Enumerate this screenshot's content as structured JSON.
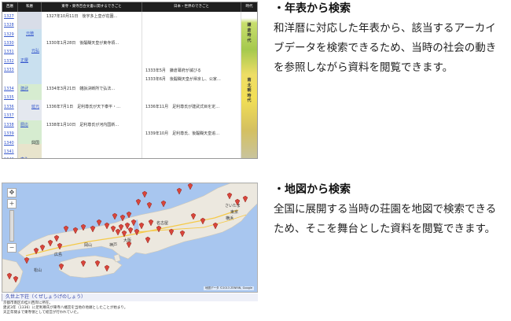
{
  "timeline": {
    "headers": [
      "西暦",
      "和暦",
      "東寺・東寺百合文書に関するできごと",
      "日本・世界のできごと",
      "時代"
    ],
    "years": [
      "1327",
      "1328",
      "1329",
      "1330",
      "1331",
      "1332",
      "1333",
      "1334",
      "1335",
      "1336",
      "1337",
      "1338",
      "1339",
      "1340",
      "1341",
      "1342"
    ],
    "eras": [
      "元徳",
      "元弘",
      "正慶",
      "建武",
      "延元",
      "暦応",
      "興国",
      "康永"
    ],
    "doc_events": [
      "1327年10月11日　後宇多上皇が荘園…",
      "1330年1月28日　後醍醐天皇が東寺領…",
      "1334年3月21日　雑訴決断所で弘法…",
      "1336年7月1日　足利尊氏が天下泰平・…",
      "1338年1月10日　足利尊氏が河内国新…"
    ],
    "gen_events": [
      "1333年5月　鎌倉幕府が滅びる",
      "1333年6月　後醍醐天皇が帰京し、公家…",
      "1336年11月　足利尊氏が建武式目を定…",
      "1339年10月　足利尊氏、後醍醐天皇追…"
    ],
    "periods": [
      "鎌倉時代",
      "南北朝時代"
    ]
  },
  "map": {
    "place_labels": [
      "さいたま",
      "東京",
      "横浜",
      "大阪",
      "神戸",
      "名古屋",
      "岡山",
      "広島",
      "松山"
    ],
    "credit": "地図データ ©2013 ZENRIN, Google",
    "caption_title": "久世上下荘（くぜしょうげのしょう）",
    "caption_lines": [
      "京都市南区の桂川西岸に所在。",
      "建武3年（1336）に足利尊氏が東寺八幡宮を当地の地頭としたことが始まり。",
      "天正年間まで東寺領として経営が行われていた。"
    ],
    "pin_color": "#d9453b"
  },
  "sections": [
    {
      "title": "・年表から検索",
      "body": "和洋暦に対応した年表から、該当するアーカイブデータを検索できるため、当時の社会の動きを参照しながら資料を閲覧できます。"
    },
    {
      "title": "・地図から検索",
      "body": "全国に展開する当時の荘園を地図で検索できるため、そこを舞台とした資料を閲覧できます。"
    }
  ]
}
